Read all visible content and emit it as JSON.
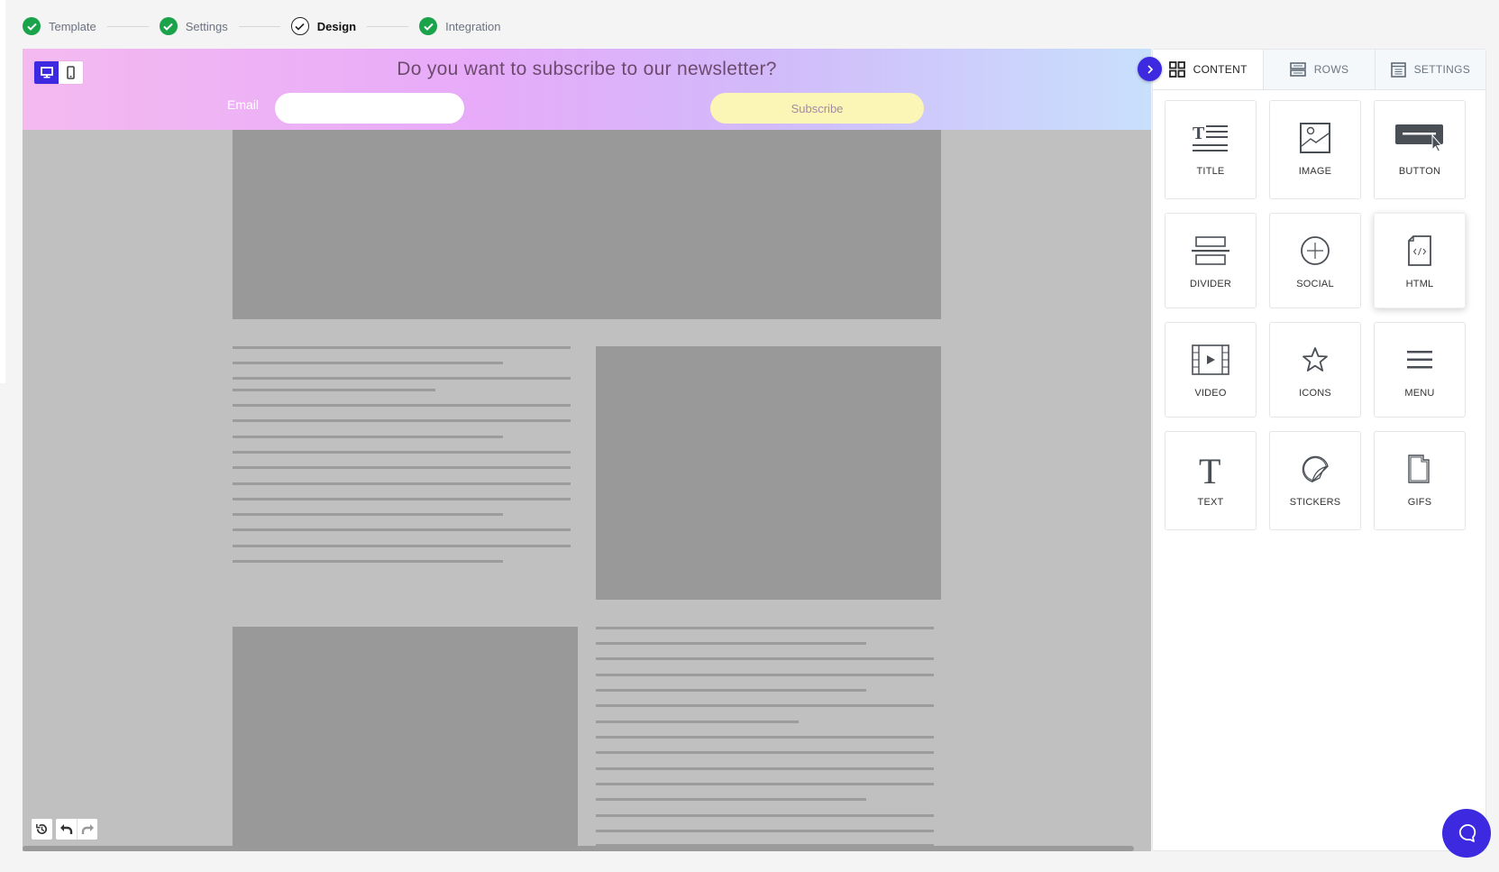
{
  "stepper": {
    "steps": [
      {
        "label": "Template",
        "state": "done"
      },
      {
        "label": "Settings",
        "state": "done"
      },
      {
        "label": "Design",
        "state": "current"
      },
      {
        "label": "Integration",
        "state": "done"
      }
    ]
  },
  "canvas": {
    "device_modes": [
      "desktop",
      "mobile"
    ],
    "selected_device": "desktop",
    "banner": {
      "title": "Do you want to subscribe to our newsletter?",
      "email_label": "Email",
      "email_value": "",
      "subscribe_label": "Subscribe"
    },
    "history": {
      "history_icon": "history-icon",
      "undo_icon": "undo-icon",
      "redo_icon": "redo-icon"
    }
  },
  "panel": {
    "collapse_icon": "chevron-right-icon",
    "tabs": [
      {
        "label": "CONTENT",
        "icon": "grid-icon",
        "active": true
      },
      {
        "label": "ROWS",
        "icon": "rows-icon",
        "active": false
      },
      {
        "label": "SETTINGS",
        "icon": "settings-doc-icon",
        "active": false
      }
    ],
    "blocks": [
      {
        "label": "TITLE",
        "icon": "title-icon"
      },
      {
        "label": "IMAGE",
        "icon": "image-icon"
      },
      {
        "label": "BUTTON",
        "icon": "button-icon"
      },
      {
        "label": "DIVIDER",
        "icon": "divider-icon"
      },
      {
        "label": "SOCIAL",
        "icon": "social-icon"
      },
      {
        "label": "HTML",
        "icon": "html-icon"
      },
      {
        "label": "VIDEO",
        "icon": "video-icon"
      },
      {
        "label": "ICONS",
        "icon": "star-icon"
      },
      {
        "label": "MENU",
        "icon": "menu-icon"
      },
      {
        "label": "TEXT",
        "icon": "text-icon"
      },
      {
        "label": "STICKERS",
        "icon": "sticker-icon"
      },
      {
        "label": "GIFS",
        "icon": "gif-icon"
      }
    ]
  },
  "colors": {
    "accent": "#3d2ae0",
    "success": "#1aa34a",
    "subscribe_bg": "#fbf5b6",
    "placeholder_gray": "#999999"
  }
}
